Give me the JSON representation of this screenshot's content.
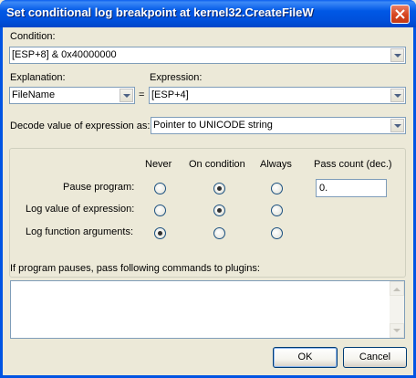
{
  "window": {
    "title": "Set conditional log breakpoint at kernel32.CreateFileW"
  },
  "condition": {
    "label": "Condition:",
    "value": "[ESP+8] & 0x40000000"
  },
  "explanation": {
    "label": "Explanation:",
    "value": "FileName"
  },
  "equals": "=",
  "expression": {
    "label": "Expression:",
    "value": "[ESP+4]"
  },
  "decode": {
    "label": "Decode value of expression as:",
    "value": "Pointer to UNICODE string"
  },
  "options": {
    "columns": [
      "Never",
      "On condition",
      "Always",
      "Pass count (dec.)"
    ],
    "rows": [
      {
        "label": "Pause program:",
        "selected": "On condition"
      },
      {
        "label": "Log value of expression:",
        "selected": "On condition"
      },
      {
        "label": "Log function arguments:",
        "selected": "Never"
      }
    ],
    "pass_count": "0."
  },
  "plugins": {
    "label": "If program pauses, pass following commands to plugins:",
    "value": ""
  },
  "buttons": {
    "ok": "OK",
    "cancel": "Cancel"
  },
  "icons": {
    "close": "close-icon",
    "dropdown": "chevron-down-icon",
    "scroll_up": "arrow-up-icon",
    "scroll_down": "arrow-down-icon"
  },
  "colors": {
    "titlebar": "#0054E3",
    "dialog_bg": "#ECE9D8",
    "close_button": "#D6451F",
    "field_border": "#7F9DB9"
  }
}
